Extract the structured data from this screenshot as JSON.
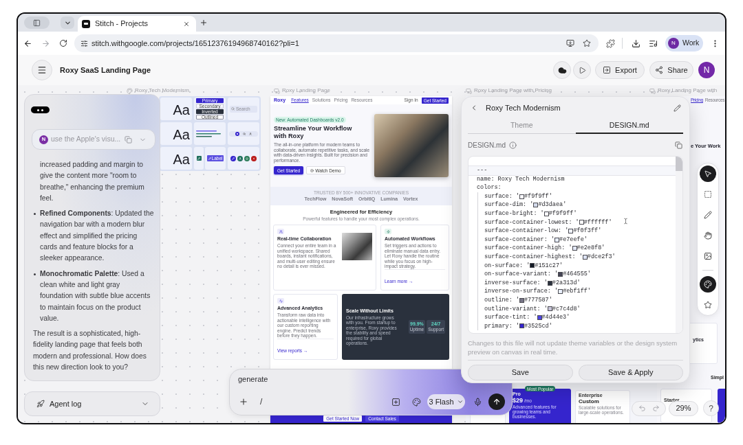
{
  "browser": {
    "tabs": [
      {
        "title": "Stitch - Projects",
        "selected": true
      }
    ],
    "url": "stitch.withgoogle.com/projects/16512376194968740162?pli=1",
    "profile": {
      "initial": "N",
      "label": "Work"
    }
  },
  "header": {
    "title": "Roxy SaaS Landing Page",
    "export": "Export",
    "share": "Share",
    "avatar": "N"
  },
  "frame_labels": [
    {
      "kind": "theme",
      "text": "Roxy Tech Modernism"
    },
    {
      "kind": "screen",
      "text": "Roxy Landing Page"
    },
    {
      "kind": "screen",
      "text": "Roxy Landing Page with Pricing"
    },
    {
      "kind": "screen",
      "text": "Roxy Landing Page with"
    }
  ],
  "design_system": {
    "type_samples": [
      "Aa",
      "Aa",
      "Aa"
    ],
    "buttons": [
      {
        "kind": "primary",
        "label": "Primary"
      },
      {
        "kind": "secondary",
        "label": "Secondary"
      },
      {
        "kind": "inverted",
        "label": "Inverted"
      },
      {
        "kind": "outlined",
        "label": "Outlined"
      }
    ],
    "search_placeholder": "Search",
    "chip": "Label",
    "swatches": [
      {
        "color": "#3525cd"
      },
      {
        "color": "#1f6f5c"
      },
      {
        "color": "#2e7d5b"
      },
      {
        "color": "#ba1a1a"
      }
    ]
  },
  "landing_page": {
    "logo": "Roxy",
    "nav": [
      {
        "label": "Features",
        "selected": true
      },
      {
        "label": "Solutions",
        "selected": false
      },
      {
        "label": "Pricing",
        "selected": false
      },
      {
        "label": "Resources",
        "selected": false
      }
    ],
    "sign_in": "Sign In",
    "cta": "Get Started",
    "badge": "New: Automated Dashboards v2.0",
    "heading": "Streamline Your Workflow with Roxy",
    "lead": "The all-in-one platform for modern teams to collaborate, automate repetitive tasks, and scale with data-driven insights. Built for precision and performance.",
    "primary_button": "Get Started",
    "secondary_button": "Watch Demo",
    "trusted_label": "TRUSTED BY 500+ INNOVATIVE COMPANIES",
    "logos": [
      "TechFlow",
      "NovaSoft",
      "OrbitIQ",
      "Lumina",
      "Vortex"
    ],
    "section_title": "Engineered for Efficiency",
    "section_subtitle": "Powerful features to handle your most complex operations.",
    "features": [
      {
        "kind": "photo",
        "title": "Real-time Collaboration",
        "text": "Connect your entire team in a unified workspace. Shared boards, instant notifications, and multi-user editing ensure no detail is ever missed."
      },
      {
        "kind": "link",
        "title": "Automated Workflows",
        "text": "Set triggers and actions to eliminate manual data entry. Let Roxy handle the routine while you focus on high-impact strategy.",
        "link": "Learn more →"
      },
      {
        "kind": "link",
        "title": "Advanced Analytics",
        "text": "Transform raw data into actionable intelligence with our custom reporting engine. Predict trends before they happen.",
        "link": "View reports →"
      },
      {
        "kind": "stats",
        "title": "Scale Without Limits",
        "text": "Our infrastructure grows with you. From startup to enterprise, Roxy provides the stability and speed required for global operations.",
        "stats": [
          {
            "value": "99.9%",
            "label": "Uptime"
          },
          {
            "value": "24/7",
            "label": "Support"
          }
        ]
      }
    ],
    "footer_buttons": [
      "Get Started Now",
      "Contact Sales"
    ]
  },
  "pricing_frame": {
    "badge": "Most Popular",
    "plans": [
      {
        "kind": "featured",
        "name": "Pro",
        "price": "$29",
        "period": "/mo",
        "description": "Advanced features for growing teams and businesses."
      },
      {
        "kind": "standard",
        "name": "Enterprise",
        "price": "Custom",
        "description": "Scalable solutions for large-scale operations."
      }
    ]
  },
  "fourth_frame": {
    "nav": [
      {
        "label": "Pricing",
        "selected": true
      },
      {
        "label": "Resources",
        "selected": false
      }
    ],
    "heading": "e Your Work",
    "card_title": "ytics",
    "section_heading": "Simpl",
    "plan": "Starter"
  },
  "chat": {
    "prompt": {
      "initial": "N",
      "text": "use the Apple's visu..."
    },
    "messages": [
      {
        "kind": "continuation",
        "text": "increased padding and margin to give the content more \"room to breathe,\" enhancing the premium feel."
      },
      {
        "kind": "bullet",
        "text": "**Refined Components**: Updated the navigation bar with a modern blur effect and simplified the pricing cards and feature blocks for a sleeker appearance."
      },
      {
        "kind": "bullet",
        "text": "**Monochromatic Palette**: Used a clean white and light gray foundation with subtle blue accents to maintain focus on the product value."
      },
      {
        "kind": "paragraph",
        "text": "The result is a sophisticated, high-fidelity landing page that feels both modern and professional. How does this new direction look to you?"
      }
    ],
    "agent_log": "Agent log"
  },
  "design_panel": {
    "title": "Roxy Tech Modernism",
    "tabs": [
      {
        "label": "Theme",
        "selected": false
      },
      {
        "label": "DESIGN.md",
        "selected": true
      }
    ],
    "file_label": "DESIGN.md",
    "code_lines": [
      {
        "kind": "rule",
        "text": "---",
        "active": true
      },
      {
        "kind": "text",
        "text": "name: Roxy Tech Modernism",
        "active": false
      },
      {
        "kind": "text",
        "text": "colors:",
        "active": false
      },
      {
        "kind": "color",
        "label": "surface: '",
        "color": "#f9f9ff",
        "value": "#f9f9ff'",
        "active": false
      },
      {
        "kind": "color",
        "label": "surface-dim: '",
        "color": "#d3daea",
        "value": "#d3daea'",
        "active": false
      },
      {
        "kind": "color",
        "label": "surface-bright: '",
        "color": "#f9f9ff",
        "value": "#f9f9ff'",
        "active": false
      },
      {
        "kind": "color",
        "label": "surface-container-lowest: '",
        "color": "#ffffff",
        "value": "#ffffff'",
        "active": false
      },
      {
        "kind": "color",
        "label": "surface-container-low: '",
        "color": "#f0f3ff",
        "value": "#f0f3ff'",
        "active": false
      },
      {
        "kind": "color",
        "label": "surface-container: '",
        "color": "#e7eefe",
        "value": "#e7eefe'",
        "active": false
      },
      {
        "kind": "color",
        "label": "surface-container-high: '",
        "color": "#e2e8f8",
        "value": "#e2e8f8'",
        "active": false
      },
      {
        "kind": "color",
        "label": "surface-container-highest: '",
        "color": "#dce2f3",
        "value": "#dce2f3'",
        "active": false
      },
      {
        "kind": "color",
        "label": "on-surface: '",
        "color": "#151c27",
        "value": "#151c27'",
        "active": false
      },
      {
        "kind": "color",
        "label": "on-surface-variant: '",
        "color": "#464555",
        "value": "#464555'",
        "active": false
      },
      {
        "kind": "color",
        "label": "inverse-surface: '",
        "color": "#2a313d",
        "value": "#2a313d'",
        "active": false
      },
      {
        "kind": "color",
        "label": "inverse-on-surface: '",
        "color": "#ebf1ff",
        "value": "#ebf1ff'",
        "active": false
      },
      {
        "kind": "color",
        "label": "outline: '",
        "color": "#777587",
        "value": "#777587'",
        "active": false
      },
      {
        "kind": "color",
        "label": "outline-variant: '",
        "color": "#c7c4d8",
        "value": "#c7c4d8'",
        "active": false
      },
      {
        "kind": "color",
        "label": "surface-tint: '",
        "color": "#4d44e3",
        "value": "#4d44e3'",
        "active": false
      },
      {
        "kind": "color",
        "label": "primary: '",
        "color": "#3525cd",
        "value": "#3525cd'",
        "active": false
      }
    ],
    "note": "Changes to this file will not update theme variables or the design system preview on canvas in real time.",
    "buttons": [
      "Save",
      "Save & Apply"
    ]
  },
  "tool_groups": [
    [
      {
        "selected": true
      },
      {
        "selected": false
      },
      {
        "selected": false
      },
      {
        "selected": false
      },
      {
        "selected": false
      }
    ],
    [
      {
        "selected": true
      },
      {
        "selected": false
      }
    ]
  ],
  "prompt": {
    "value": "generate",
    "shortcut": "/",
    "model": "3 Flash"
  },
  "zoom": {
    "value": "29%",
    "help": "?"
  }
}
